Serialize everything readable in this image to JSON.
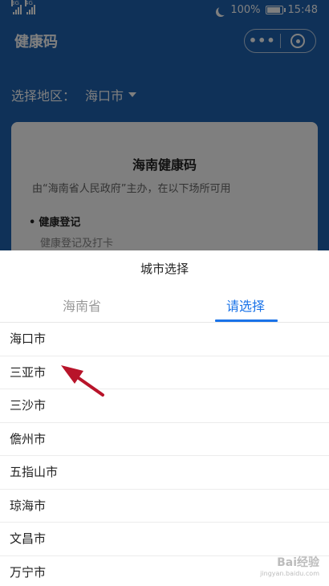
{
  "status_bar": {
    "signal_1": "3G",
    "signal_2": "4G",
    "battery": "100%",
    "time": "15:48"
  },
  "header": {
    "title": "健康码",
    "more": "•••"
  },
  "region": {
    "label": "选择地区：",
    "value": "海口市"
  },
  "card": {
    "title": "海南健康码",
    "subtitle": "由“海南省人民政府”主办，在以下场所可用",
    "item": "健康登记",
    "item_desc": "健康登记及打卡"
  },
  "sheet": {
    "title": "城市选择",
    "tabs": [
      {
        "label": "海南省",
        "active": false
      },
      {
        "label": "请选择",
        "active": true
      }
    ],
    "cities": [
      "海口市",
      "三亚市",
      "三沙市",
      "儋州市",
      "五指山市",
      "琼海市",
      "文昌市",
      "万宁市"
    ]
  },
  "watermark": {
    "logo": "Bai经验",
    "url": "jingyan.baidu.com"
  },
  "colors": {
    "header_bg": "#1e63b0",
    "accent": "#1a73e8",
    "arrow": "#b8142a"
  }
}
